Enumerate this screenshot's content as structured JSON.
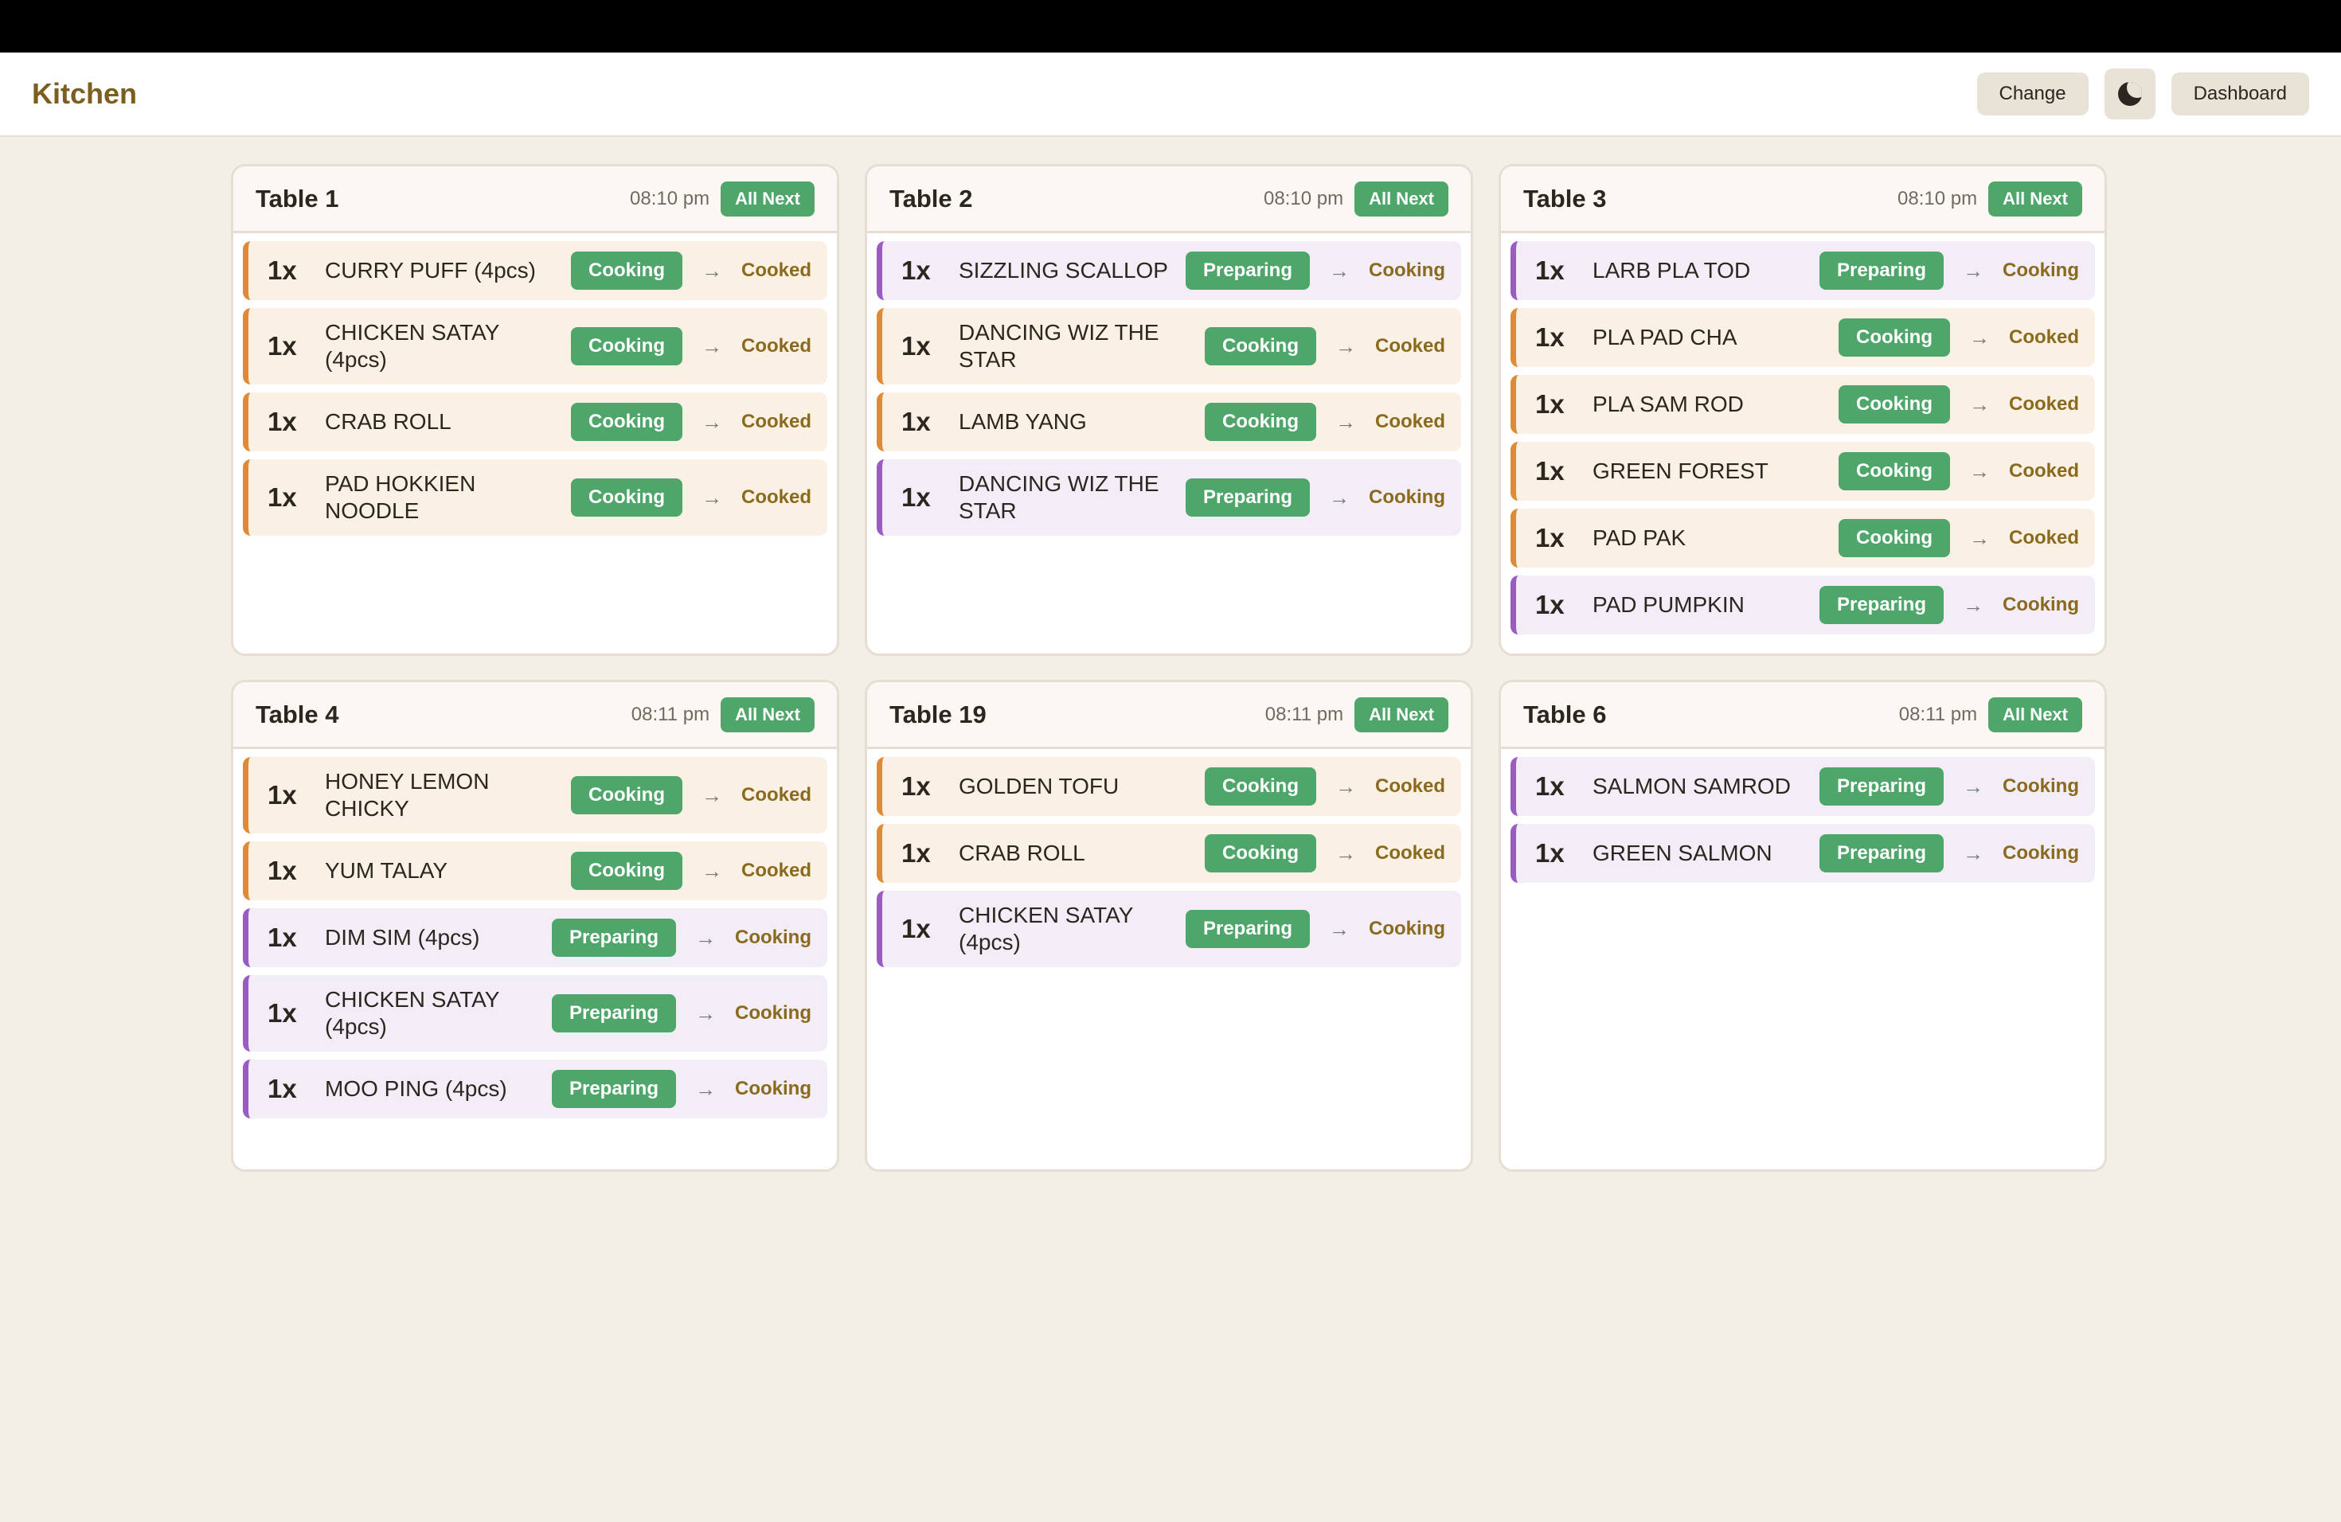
{
  "app": {
    "title": "Kitchen"
  },
  "header": {
    "change_label": "Change",
    "theme_icon": "moon-icon",
    "dashboard_label": "Dashboard"
  },
  "colors": {
    "cooking_accent": "#e08a36",
    "preparing_accent": "#9a5cc4",
    "status_green": "#4fa66a",
    "brand": "#7a5f1e"
  },
  "tables": [
    {
      "name": "Table 1",
      "time": "08:10 pm",
      "all_next": "All Next",
      "items": [
        {
          "qty": "1x",
          "name": "CURRY PUFF (4pcs)",
          "status": "Cooking",
          "next": "Cooked"
        },
        {
          "qty": "1x",
          "name": "CHICKEN SATAY (4pcs)",
          "status": "Cooking",
          "next": "Cooked"
        },
        {
          "qty": "1x",
          "name": "CRAB ROLL",
          "status": "Cooking",
          "next": "Cooked"
        },
        {
          "qty": "1x",
          "name": "PAD HOKKIEN NOODLE",
          "status": "Cooking",
          "next": "Cooked"
        }
      ]
    },
    {
      "name": "Table 2",
      "time": "08:10 pm",
      "all_next": "All Next",
      "items": [
        {
          "qty": "1x",
          "name": "SIZZLING SCALLOP",
          "status": "Preparing",
          "next": "Cooking"
        },
        {
          "qty": "1x",
          "name": "DANCING WIZ THE STAR",
          "status": "Cooking",
          "next": "Cooked"
        },
        {
          "qty": "1x",
          "name": "LAMB YANG",
          "status": "Cooking",
          "next": "Cooked"
        },
        {
          "qty": "1x",
          "name": "DANCING WIZ THE STAR",
          "status": "Preparing",
          "next": "Cooking"
        }
      ]
    },
    {
      "name": "Table 3",
      "time": "08:10 pm",
      "all_next": "All Next",
      "items": [
        {
          "qty": "1x",
          "name": "LARB PLA TOD",
          "status": "Preparing",
          "next": "Cooking"
        },
        {
          "qty": "1x",
          "name": "PLA PAD CHA",
          "status": "Cooking",
          "next": "Cooked"
        },
        {
          "qty": "1x",
          "name": "PLA SAM ROD",
          "status": "Cooking",
          "next": "Cooked"
        },
        {
          "qty": "1x",
          "name": "GREEN FOREST",
          "status": "Cooking",
          "next": "Cooked"
        },
        {
          "qty": "1x",
          "name": "PAD PAK",
          "status": "Cooking",
          "next": "Cooked"
        },
        {
          "qty": "1x",
          "name": "PAD PUMPKIN",
          "status": "Preparing",
          "next": "Cooking"
        }
      ]
    },
    {
      "name": "Table 4",
      "time": "08:11 pm",
      "all_next": "All Next",
      "items": [
        {
          "qty": "1x",
          "name": "HONEY LEMON CHICKY",
          "status": "Cooking",
          "next": "Cooked"
        },
        {
          "qty": "1x",
          "name": "YUM TALAY",
          "status": "Cooking",
          "next": "Cooked"
        },
        {
          "qty": "1x",
          "name": "DIM SIM (4pcs)",
          "status": "Preparing",
          "next": "Cooking"
        },
        {
          "qty": "1x",
          "name": "CHICKEN SATAY (4pcs)",
          "status": "Preparing",
          "next": "Cooking"
        },
        {
          "qty": "1x",
          "name": "MOO PING (4pcs)",
          "status": "Preparing",
          "next": "Cooking"
        }
      ]
    },
    {
      "name": "Table 19",
      "time": "08:11 pm",
      "all_next": "All Next",
      "items": [
        {
          "qty": "1x",
          "name": "GOLDEN TOFU",
          "status": "Cooking",
          "next": "Cooked"
        },
        {
          "qty": "1x",
          "name": "CRAB ROLL",
          "status": "Cooking",
          "next": "Cooked"
        },
        {
          "qty": "1x",
          "name": "CHICKEN SATAY (4pcs)",
          "status": "Preparing",
          "next": "Cooking"
        }
      ]
    },
    {
      "name": "Table 6",
      "time": "08:11 pm",
      "all_next": "All Next",
      "items": [
        {
          "qty": "1x",
          "name": "SALMON SAMROD",
          "status": "Preparing",
          "next": "Cooking"
        },
        {
          "qty": "1x",
          "name": "GREEN SALMON",
          "status": "Preparing",
          "next": "Cooking"
        }
      ]
    }
  ]
}
